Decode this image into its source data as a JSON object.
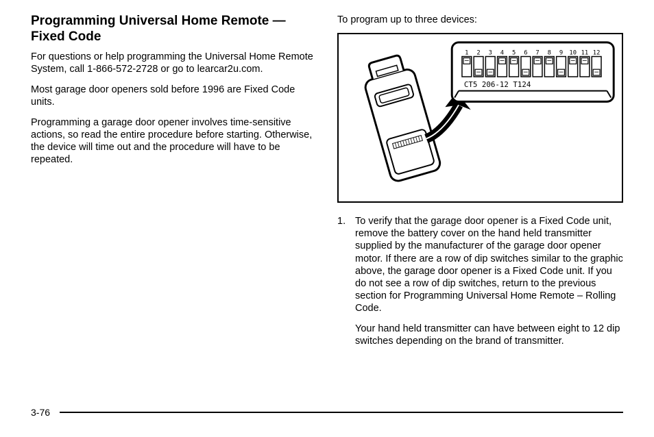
{
  "left": {
    "heading": "Programming Universal Home Remote — Fixed Code",
    "p1": "For questions or help programming the Universal Home Remote System, call 1-866-572-2728 or go to learcar2u.com.",
    "p2": "Most garage door openers sold before 1996 are Fixed Code units.",
    "p3": "Programming a garage door opener involves time-sensitive actions, so read the entire procedure before starting. Otherwise, the device will time out and the procedure will have to be repeated."
  },
  "right": {
    "lead": "To program up to three devices:",
    "figure": {
      "dip_numbers": [
        "1",
        "2",
        "3",
        "4",
        "5",
        "6",
        "7",
        "8",
        "9",
        "10",
        "11",
        "12"
      ],
      "dip_label": "CT5  206-12    T124"
    },
    "step1_marker": "1.",
    "step1_text": "To verify that the garage door opener is a Fixed Code unit, remove the battery cover on the hand held transmitter supplied by the manufacturer of the garage door opener motor. If there are a row of dip switches similar to the graphic above, the garage door opener is a Fixed Code unit. If you do not see a row of dip switches, return to the previous section for Programming Universal Home Remote – Rolling Code.",
    "step1_sub": "Your hand held transmitter can have between eight to 12 dip switches depending on the brand of transmitter."
  },
  "page_number": "3-76"
}
